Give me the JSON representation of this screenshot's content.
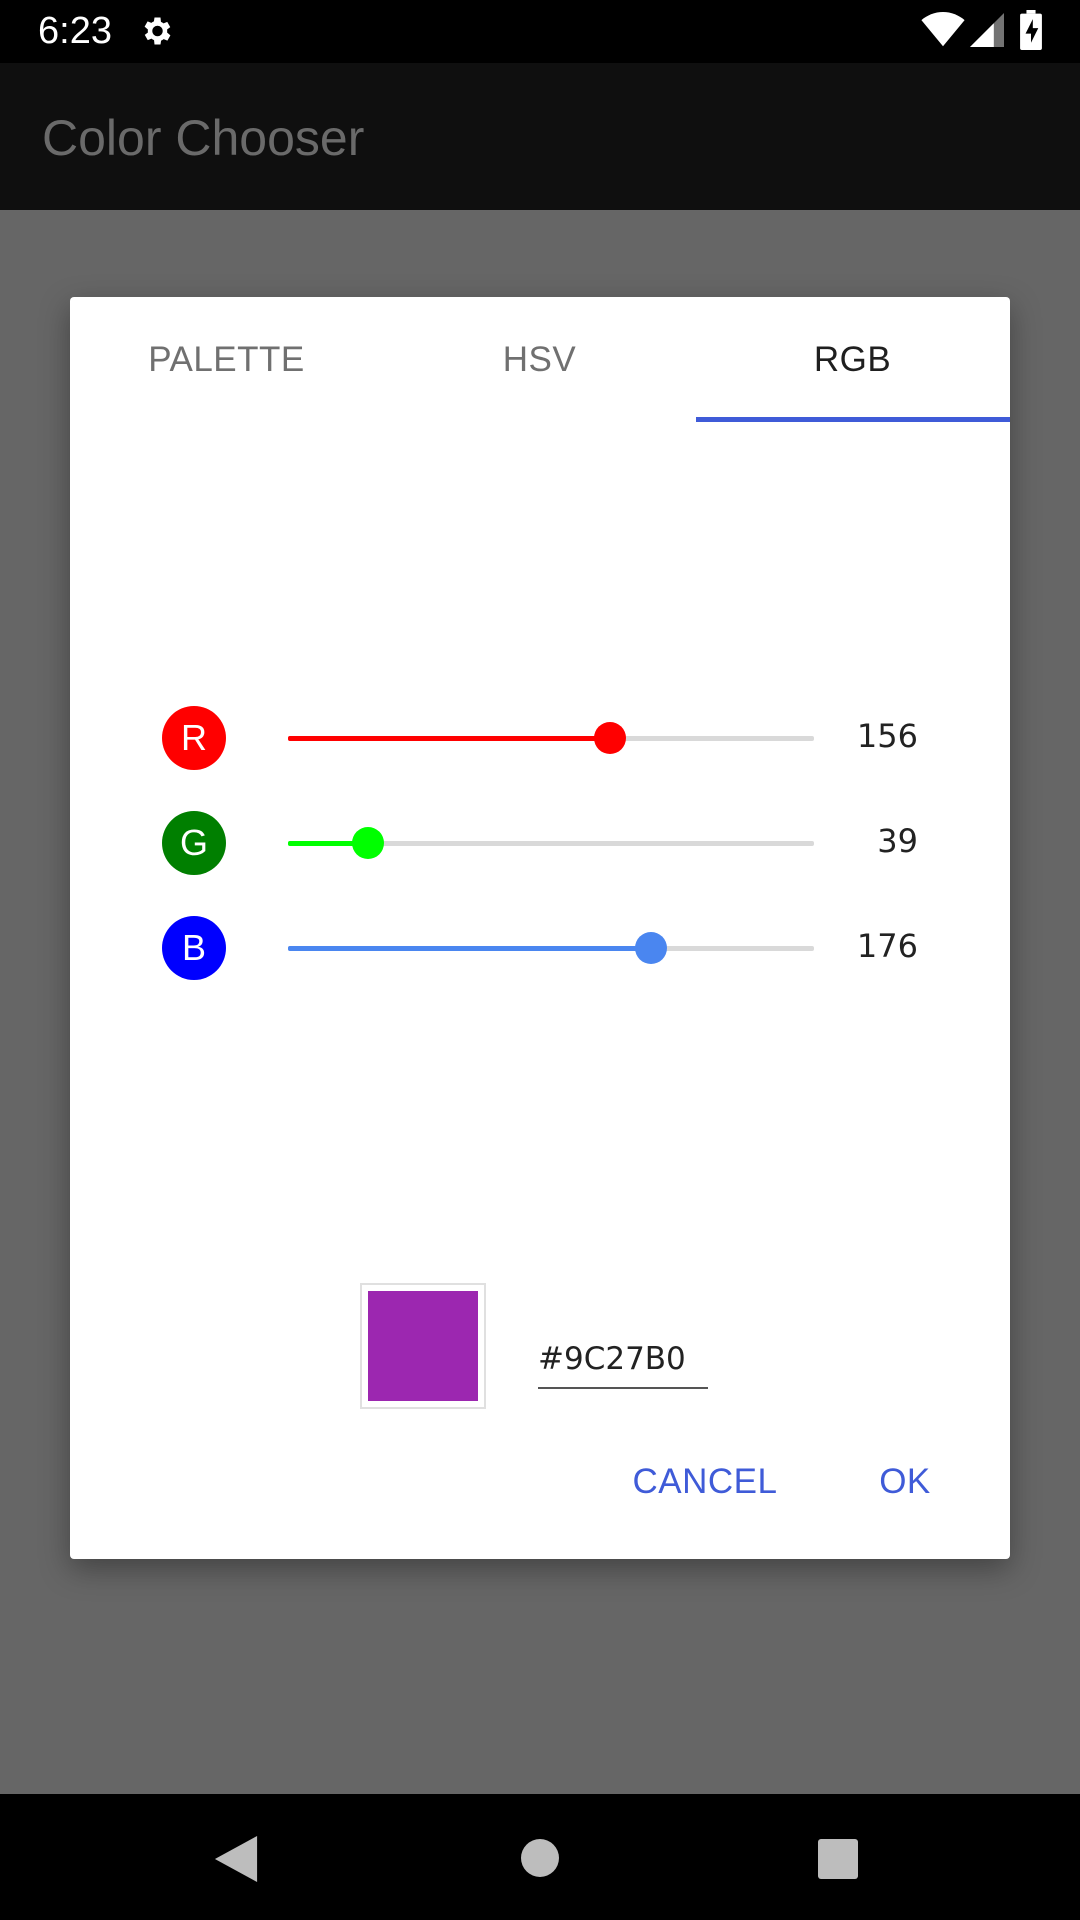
{
  "status_bar": {
    "time": "6:23",
    "icons": [
      "gear-icon",
      "wifi-icon",
      "signal-icon",
      "battery-charging-icon"
    ]
  },
  "app_bar": {
    "title": "Color Chooser"
  },
  "dialog": {
    "tabs": [
      {
        "label": "PALETTE",
        "selected": false
      },
      {
        "label": "HSV",
        "selected": false
      },
      {
        "label": "RGB",
        "selected": true
      }
    ],
    "accent_color": "#3F5BD8",
    "channels": [
      {
        "letter": "R",
        "value": "156",
        "max": 255,
        "badge_color": "#FF0000",
        "track_color": "#FF0000",
        "thumb_color": "#FF0000"
      },
      {
        "letter": "G",
        "value": "39",
        "max": 255,
        "badge_color": "#007F00",
        "track_color": "#00FF00",
        "thumb_color": "#00FF00"
      },
      {
        "letter": "B",
        "value": "176",
        "max": 255,
        "badge_color": "#0000FF",
        "track_color": "#4A86F0",
        "thumb_color": "#4A86F0"
      }
    ],
    "preview_color": "#9C27B0",
    "hex_value": "#9C27B0",
    "buttons": {
      "cancel": "CANCEL",
      "ok": "OK"
    }
  },
  "nav_bar": {
    "icons": [
      "back-icon",
      "home-icon",
      "recents-icon"
    ]
  }
}
